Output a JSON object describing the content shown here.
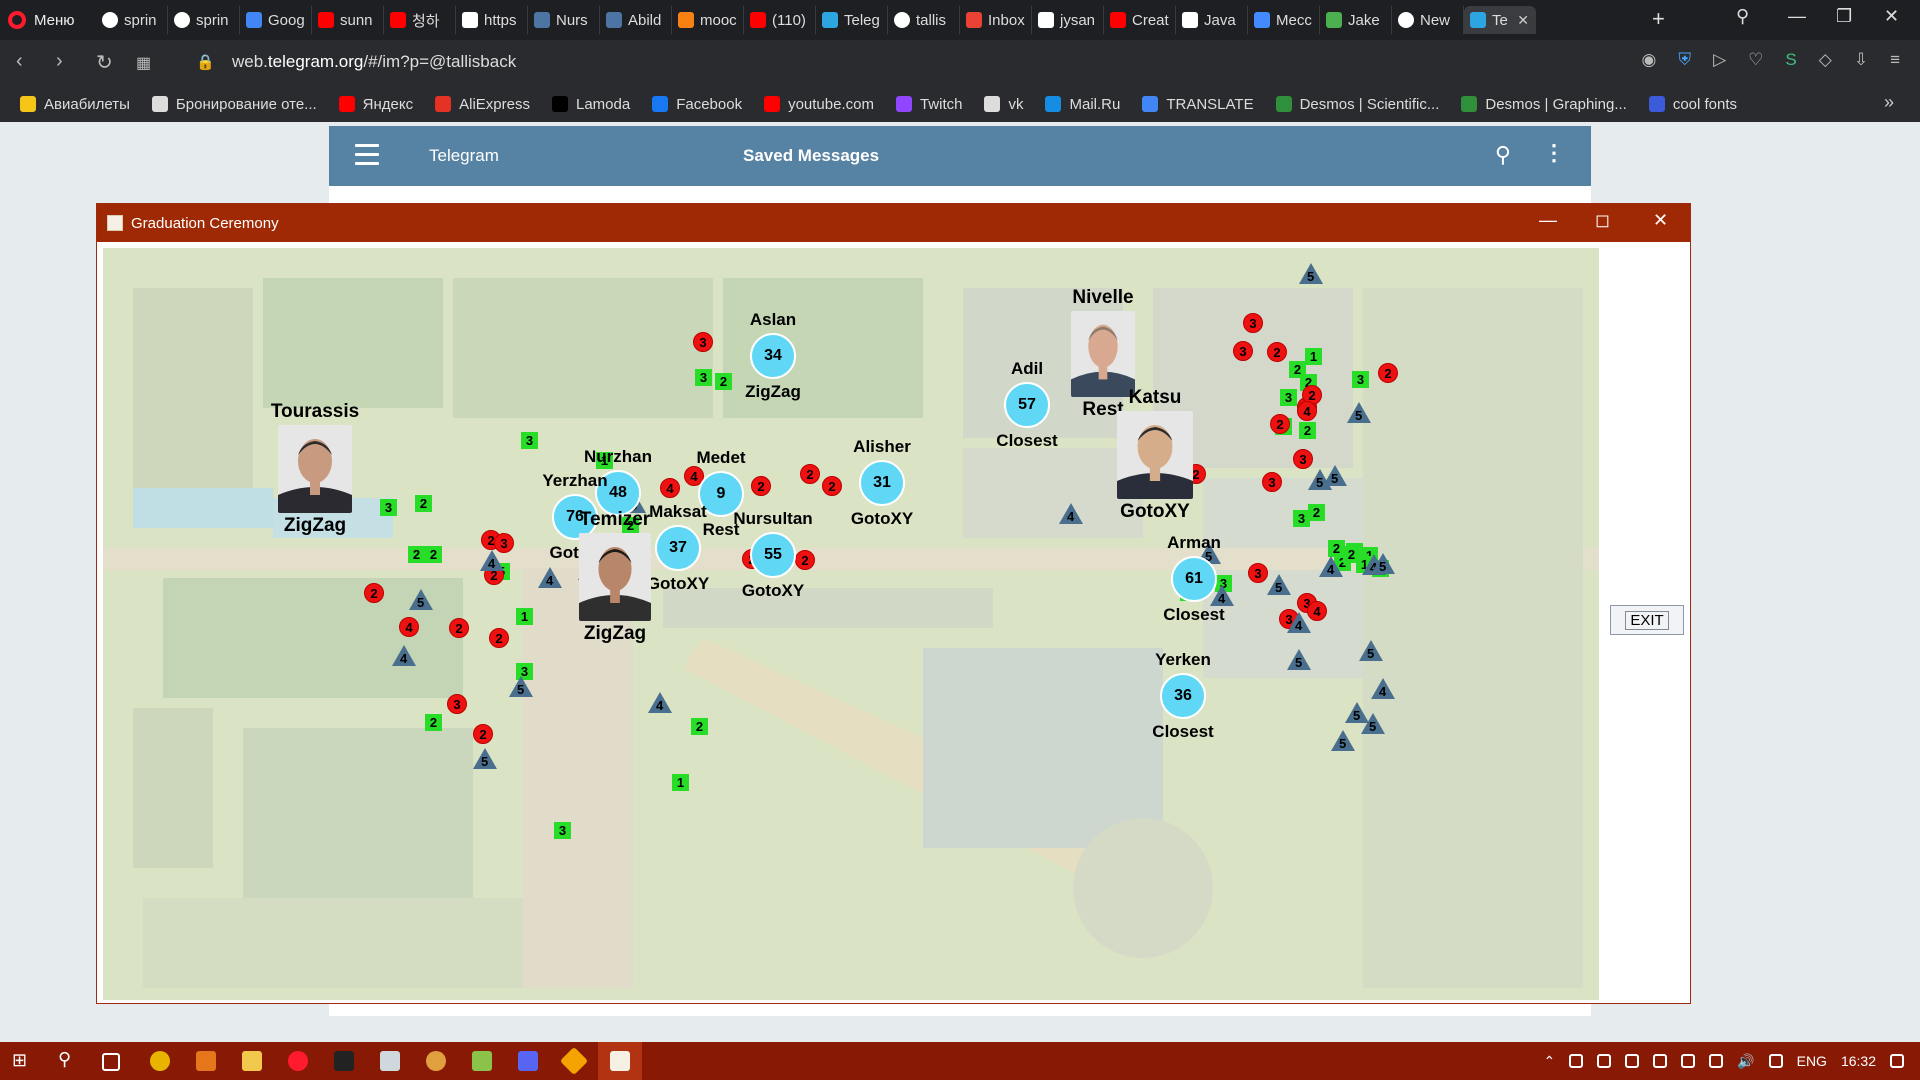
{
  "browser": {
    "menu_label": "Меню",
    "tabs": [
      {
        "label": "sprin",
        "icon": "github-icon",
        "color": "#ffffff"
      },
      {
        "label": "sprin",
        "icon": "github-icon",
        "color": "#ffffff"
      },
      {
        "label": "Goog",
        "icon": "google-translate-icon",
        "color": "#4285f4"
      },
      {
        "label": "sunn",
        "icon": "youtube-icon",
        "color": "#ff0000"
      },
      {
        "label": "청하",
        "icon": "youtube-icon",
        "color": "#ff0000"
      },
      {
        "label": "https",
        "icon": "hand-icon",
        "color": "#ffffff"
      },
      {
        "label": "Nurs",
        "icon": "vk-icon",
        "color": "#4c75a3"
      },
      {
        "label": "Abild",
        "icon": "vk-icon",
        "color": "#4c75a3"
      },
      {
        "label": "mooc",
        "icon": "moodle-icon",
        "color": "#f98012"
      },
      {
        "label": "(110)",
        "icon": "youtube-icon",
        "color": "#ff0000"
      },
      {
        "label": "Teleg",
        "icon": "telegram-icon",
        "color": "#2ca5e0"
      },
      {
        "label": "tallis",
        "icon": "github-icon",
        "color": "#ffffff"
      },
      {
        "label": "Inbox",
        "icon": "gmail-icon",
        "color": "#ea4335"
      },
      {
        "label": "jysan",
        "icon": "google-icon",
        "color": "#ffffff"
      },
      {
        "label": "Creat",
        "icon": "youtube-icon",
        "color": "#ff0000"
      },
      {
        "label": "Java",
        "icon": "bolt-icon",
        "color": "#ffffff"
      },
      {
        "label": "Mecc",
        "icon": "messenger-icon",
        "color": "#448aff"
      },
      {
        "label": "Jake",
        "icon": "leaf-icon",
        "color": "#4caf50"
      },
      {
        "label": "New",
        "icon": "github-icon",
        "color": "#ffffff"
      },
      {
        "label": "Te",
        "icon": "telegram-icon",
        "color": "#2ca5e0",
        "active": true
      }
    ],
    "url_prefix": "web.",
    "url_domain": "telegram.org",
    "url_rest": "/#/im?p=@tallisback",
    "bookmarks": [
      {
        "label": "Авиабилеты",
        "color": "#f5c518"
      },
      {
        "label": "Бронирование оте...",
        "color": "#dddddd"
      },
      {
        "label": "Яндекс",
        "color": "#ff0000"
      },
      {
        "label": "AliExpress",
        "color": "#e43225"
      },
      {
        "label": "Lamoda",
        "color": "#000000"
      },
      {
        "label": "Facebook",
        "color": "#1877f2"
      },
      {
        "label": "youtube.com",
        "color": "#ff0000"
      },
      {
        "label": "Twitch",
        "color": "#9146ff"
      },
      {
        "label": "vk",
        "color": "#dddddd"
      },
      {
        "label": "Mail.Ru",
        "color": "#168de2"
      },
      {
        "label": "TRANSLATE",
        "color": "#4285f4"
      },
      {
        "label": "Desmos | Scientific...",
        "color": "#2f8f3a"
      },
      {
        "label": "Desmos | Graphing...",
        "color": "#2f8f3a"
      },
      {
        "label": "cool fonts",
        "color": "#3b5bdb"
      }
    ]
  },
  "telegram": {
    "app_title": "Telegram",
    "chat_title": "Saved Messages"
  },
  "window": {
    "title": "Graduation Ceremony",
    "exit_label": "EXIT"
  },
  "map": {
    "photos": [
      {
        "name": "Tourassis",
        "mode": "ZigZag",
        "skin": "#c89a80",
        "hair": "#2b2b2b",
        "suit": "#2a2a30"
      },
      {
        "name": "Temizer",
        "mode": "ZigZag",
        "skin": "#b8876a",
        "hair": "#1d1a18",
        "suit": "#2f2f2f"
      },
      {
        "name": "Nivelle",
        "mode": "Rest",
        "skin": "#d8a890",
        "hair": "#8a7a6a",
        "suit": "#3a4a5c"
      },
      {
        "name": "Katsu",
        "mode": "GotoXY",
        "skin": "#d6ad8a",
        "hair": "#2b2b2b",
        "suit": "#2a2e3a"
      }
    ],
    "bubbles": [
      {
        "name": "Aslan",
        "num": "34",
        "mode": "ZigZag"
      },
      {
        "name": "Adil",
        "num": "57",
        "mode": "Closest"
      },
      {
        "name": "Nurzhan",
        "num": "48",
        "mode": ""
      },
      {
        "name": "Yerzhan",
        "num": "76",
        "mode": "GotoX"
      },
      {
        "name": "Medet",
        "num": "9",
        "mode": "Rest"
      },
      {
        "name": "Alisher",
        "num": "31",
        "mode": "GotoXY"
      },
      {
        "name": "Maksat",
        "num": "37",
        "mode": "GotoXY"
      },
      {
        "name": "Nursultan",
        "num": "55",
        "mode": "GotoXY"
      },
      {
        "name": "Arman",
        "num": "61",
        "mode": "Closest"
      },
      {
        "name": "Yerken",
        "num": "36",
        "mode": "Closest"
      }
    ],
    "greens": [
      "3",
      "2",
      "1",
      "3",
      "1",
      "2",
      "3",
      "2",
      "3",
      "2",
      "2",
      "5",
      "2",
      "1",
      "2",
      "1",
      "2",
      "3",
      "1",
      "3",
      "2",
      "1",
      "2",
      "3",
      "2",
      "1",
      "3",
      "2",
      "3",
      "2",
      "1",
      "2",
      "1",
      "2",
      "1",
      "3"
    ],
    "reds": [
      "3",
      "2",
      "2",
      "2",
      "2",
      "3",
      "2",
      "2",
      "4",
      "2",
      "2",
      "3",
      "2",
      "2",
      "2",
      "4",
      "4",
      "2",
      "3",
      "3",
      "2",
      "2",
      "4",
      "2",
      "3",
      "4",
      "3",
      "3",
      "3",
      "4",
      "3",
      "2"
    ],
    "tris": [
      "5",
      "5",
      "5",
      "4",
      "5",
      "4",
      "5",
      "5",
      "4",
      "5",
      "5",
      "5",
      "5",
      "5",
      "4",
      "4",
      "5",
      "4",
      "4",
      "5",
      "4",
      "4",
      "4",
      "5",
      "4",
      "5",
      "4",
      "5"
    ]
  },
  "taskbar": {
    "lang": "ENG",
    "time": "16:32"
  }
}
